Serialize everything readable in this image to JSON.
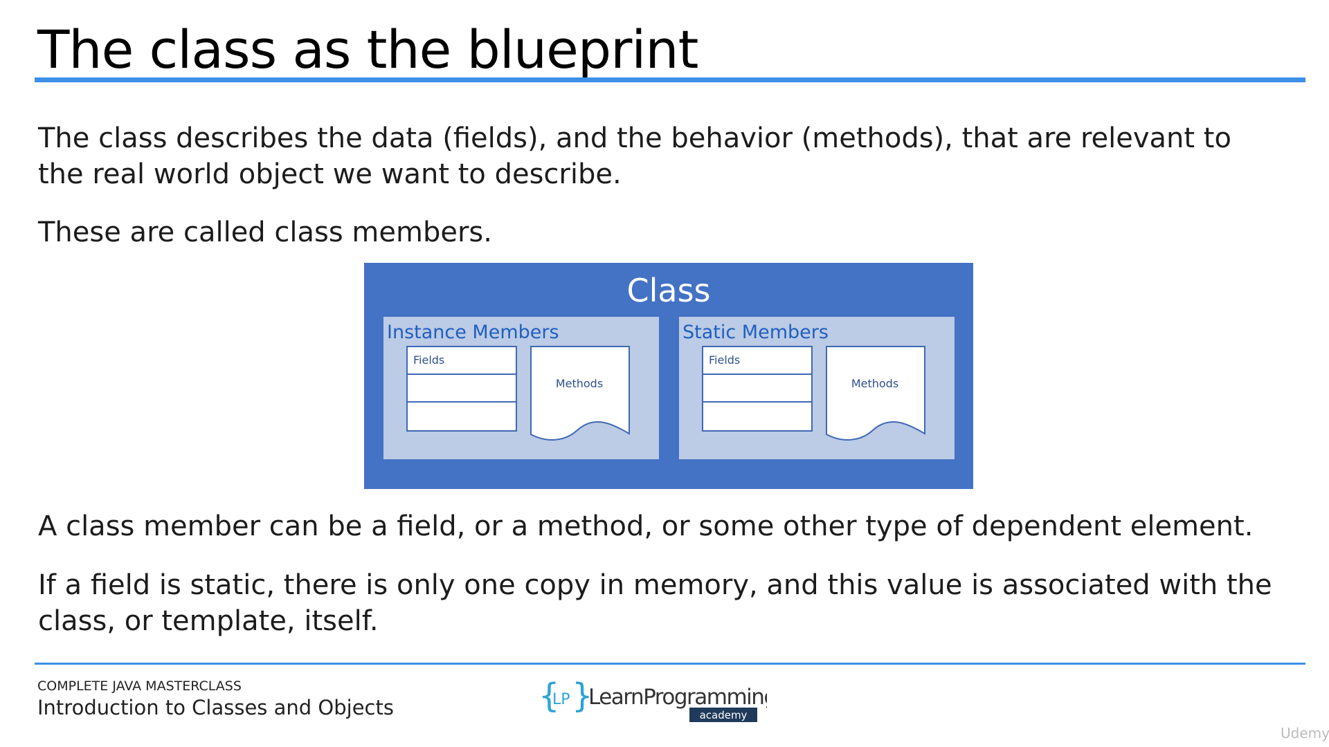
{
  "slide": {
    "title": "The class as the blueprint",
    "paragraphs": [
      "The class describes the data (fields), and the behavior (methods), that are relevant to the real world object we want to describe.",
      "These are called class members.",
      "A class member can be a field, or a method, or some other type of dependent element.",
      "If a field is static, there is only one copy in memory, and this value is associated with the class, or template, itself."
    ]
  },
  "diagram": {
    "title": "Class",
    "panels": [
      {
        "title": "Instance Members",
        "fields_label": "Fields",
        "methods_label": "Methods"
      },
      {
        "title": "Static Members",
        "fields_label": "Fields",
        "methods_label": "Methods"
      }
    ]
  },
  "footer": {
    "course": "COMPLETE JAVA MASTERCLASS",
    "lesson": "Introduction to Classes and Objects",
    "logo": {
      "bracket_text": "LP",
      "name": "LearnProgramming",
      "sub": "academy"
    },
    "watermark": "Udemy"
  },
  "colors": {
    "accent_rule": "#3c8fe6",
    "diagram_bg": "#4472c4",
    "panel_bg": "#bccbe6",
    "panel_title": "#1f5fbf"
  }
}
